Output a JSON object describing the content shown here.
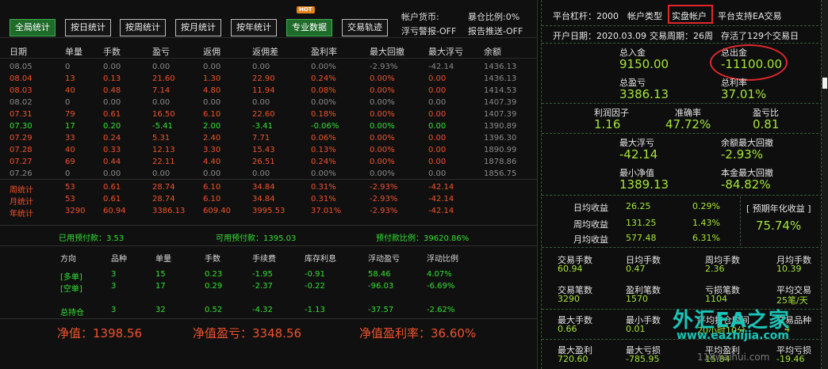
{
  "toolbar": {
    "buttons": [
      "全局统计",
      "按日统计",
      "按周统计",
      "按月统计",
      "按年统计",
      "专业数据",
      "交易轨迹"
    ],
    "hot_badge": "HOT",
    "account_currency": "帐户货币:",
    "loss_ratio": "暴仓比例:0%",
    "float_warning": "浮亏警报-OFF",
    "report_push": "报告推送-OFF"
  },
  "table": {
    "headers": [
      "日期",
      "单量",
      "手数",
      "盈亏",
      "返佣",
      "返佣差",
      "盈利率",
      "最大回撤",
      "最大浮亏",
      "余额"
    ],
    "rows": [
      {
        "tone": "grey",
        "cells": [
          "08.05",
          "0",
          "0.00",
          "0.00",
          "0.00",
          "0.00",
          "0.00%",
          "-2.93%",
          "-42.14",
          "1436.13"
        ]
      },
      {
        "tone": "red",
        "cells": [
          "08.04",
          "13",
          "0.13",
          "21.60",
          "1.30",
          "22.90",
          "0.24%",
          "0.00%",
          "0.00",
          "1436.13"
        ]
      },
      {
        "tone": "red",
        "cells": [
          "08.03",
          "40",
          "0.48",
          "7.14",
          "4.80",
          "11.94",
          "0.08%",
          "0.00%",
          "0.00",
          "1414.53"
        ]
      },
      {
        "tone": "grey",
        "cells": [
          "08.02",
          "0",
          "0.00",
          "0.00",
          "0.00",
          "0.00",
          "0.00%",
          "0.00%",
          "0.00",
          "1407.39"
        ]
      },
      {
        "tone": "red",
        "cells": [
          "07.31",
          "79",
          "0.61",
          "16.50",
          "6.10",
          "22.60",
          "0.18%",
          "0.00%",
          "0.00",
          "1407.39"
        ]
      },
      {
        "tone": "green",
        "cells": [
          "07.30",
          "17",
          "0.20",
          "-5.41",
          "2.00",
          "-3.41",
          "-0.06%",
          "0.00%",
          "0.00",
          "1390.89"
        ]
      },
      {
        "tone": "red",
        "cells": [
          "07.29",
          "33",
          "0.24",
          "5.31",
          "2.40",
          "7.71",
          "0.06%",
          "0.00%",
          "0.00",
          "1396.30"
        ]
      },
      {
        "tone": "red",
        "cells": [
          "07.28",
          "40",
          "0.33",
          "12.13",
          "3.30",
          "15.43",
          "0.13%",
          "0.00%",
          "0.00",
          "1890.99"
        ]
      },
      {
        "tone": "red",
        "cells": [
          "07.27",
          "69",
          "0.44",
          "22.11",
          "4.40",
          "26.51",
          "0.24%",
          "0.00%",
          "0.00",
          "1878.86"
        ]
      },
      {
        "tone": "grey",
        "cells": [
          "07.26",
          "0",
          "0.00",
          "0.00",
          "0.00",
          "0.00",
          "0.00%",
          "0.00%",
          "0.00",
          "1856.75"
        ]
      }
    ],
    "summary": [
      {
        "cells": [
          "周统计",
          "53",
          "0.61",
          "28.74",
          "6.10",
          "34.84",
          "0.31%",
          "-2.93%",
          "-42.14",
          ""
        ]
      },
      {
        "cells": [
          "月统计",
          "53",
          "0.61",
          "28.74",
          "6.10",
          "34.84",
          "0.31%",
          "-2.93%",
          "-42.14",
          ""
        ]
      },
      {
        "cells": [
          "年统计",
          "3290",
          "60.94",
          "3386.13",
          "609.40",
          "3995.53",
          "37.01%",
          "-2.93%",
          "-42.14",
          ""
        ]
      }
    ]
  },
  "prepaid": {
    "used": "已用预付款：3.53",
    "available": "可用预付款：1395.03",
    "ratio": "预付款比例：39620.86%"
  },
  "positions": {
    "headers": [
      "方向",
      "品种",
      "单量",
      "手数",
      "手续费",
      "库存利息",
      "浮动盈亏",
      "浮动比例"
    ],
    "rows": [
      {
        "cells": [
          "[多单]",
          "3",
          "15",
          "0.23",
          "-1.95",
          "-0.91",
          "58.46",
          "4.07%"
        ]
      },
      {
        "cells": [
          "[空单]",
          "3",
          "17",
          "0.29",
          "-2.37",
          "-0.22",
          "-96.03",
          "-6.69%"
        ]
      },
      {
        "cells": [
          "总持仓",
          "3",
          "32",
          "0.52",
          "-4.32",
          "-1.13",
          "-37.57",
          "-2.62%"
        ]
      }
    ]
  },
  "totals": {
    "net_value": "净值：1398.56",
    "net_pl": "净值盈亏：3348.56",
    "net_rate": "净值盈利率：36.60%"
  },
  "panel": {
    "leverage": "平台杠杆：2000",
    "account_type_label": "帐户类型",
    "account_type": "实盘帐户",
    "ea_support": "平台支持EA交易",
    "open_date": "开户日期：2020.03.09",
    "period": "交易周期：26周",
    "alive": "存活了129个交易日",
    "deposit_label": "总入金",
    "deposit": "9150.00",
    "withdraw_label": "总出金",
    "withdraw": "-11100.00",
    "profit_label": "总盈亏",
    "profit": "3386.13",
    "profit_rate_label": "总利率",
    "profit_rate": "37.01%",
    "pf_label": "利润因子",
    "pf": "1.16",
    "accuracy_label": "准确率",
    "accuracy": "47.72%",
    "plratio_label": "盈亏比",
    "plratio": "0.81",
    "maxfloat_label": "最大浮亏",
    "maxfloat": "-42.14",
    "maxdd_label": "余额最大回撤",
    "maxdd": "-2.93%",
    "minequity_label": "最小净值",
    "minequity": "1389.13",
    "capdd_label": "本金最大回撤",
    "capdd": "-84.82%",
    "daily_label": "日均收益",
    "daily": "26.25",
    "daily_pct": "0.29%",
    "weekly_label": "周均收益",
    "weekly": "131.25",
    "weekly_pct": "1.43%",
    "monthly_label": "月均收益",
    "monthly": "577.48",
    "monthly_pct": "6.31%",
    "annual_label": "[ 预期年化收益 ]",
    "annual": "75.74%",
    "lots_label": "交易手数",
    "lots": "60.94",
    "daylots_label": "日均手数",
    "daylots": "0.47",
    "weeklots_label": "周均手数",
    "weeklots": "2.36",
    "monthlots_label": "月均手数",
    "monthlots": "10.39",
    "trades_label": "交易笔数",
    "trades": "3290",
    "wins_label": "盈利笔数",
    "wins": "1570",
    "losses_label": "亏损笔数",
    "losses": "1104",
    "avgtrade_label": "平均交易",
    "avgtrade": "25笔/天",
    "maxlots_label": "最大手数",
    "maxlots": "0.66",
    "minlots_label": "最小手数",
    "minlots": "0.01",
    "avghold_label": "平均持仓时间",
    "avghold": "20小时10分",
    "products_label": "交易品种",
    "products": "4",
    "maxwin_label": "最大盈利",
    "maxwin": "720.60",
    "maxloss_label": "最大亏损",
    "maxloss": "-785.95",
    "avgwin_label": "平均盈利",
    "avgwin": "15.84",
    "avgloss_label": "平均亏损",
    "avgloss": "-19.46"
  },
  "watermark": {
    "line1": "外汇EA之家",
    "line2": "www.eazhijia.com",
    "line3": "118waihui.com"
  },
  "colors": {
    "red": "#f0532e",
    "green": "#35e035",
    "lime": "#a6e63a",
    "highlight": "#e0282c"
  }
}
